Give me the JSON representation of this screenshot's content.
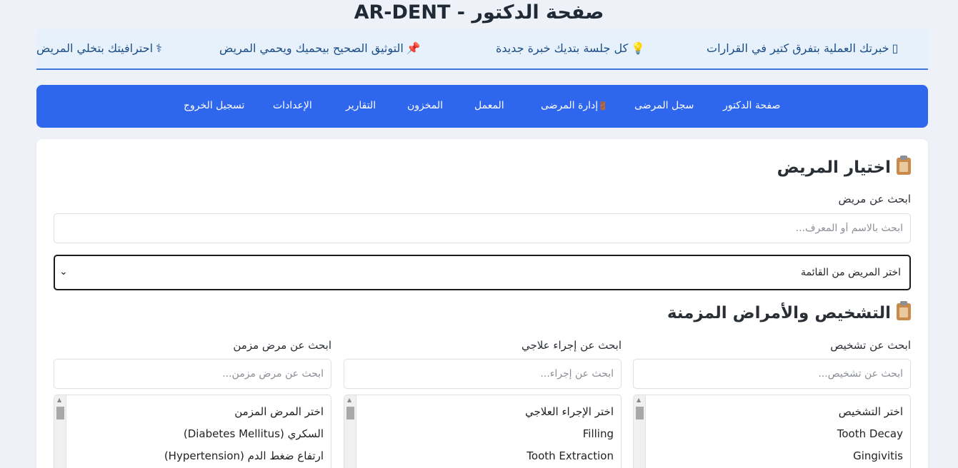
{
  "page": {
    "title": "AR-DENT - صفحة الدكتور"
  },
  "ticker": {
    "items": [
      {
        "icon": "stethoscope-icon",
        "glyph": "⚕",
        "text": "احترافيتك بتخلي المريض"
      },
      {
        "icon": "pushpin-icon",
        "glyph": "📌",
        "text": "التوثيق الصحيح بيحميك ويحمي المريض"
      },
      {
        "icon": "lightbulb-icon",
        "glyph": "💡",
        "text": "كل جلسة بتديك خبرة جديدة"
      },
      {
        "icon": "missing-glyph-icon",
        "glyph": "▯",
        "text": "خبرتك العملية بتفرق كتير في القرارات"
      }
    ]
  },
  "nav": {
    "items": [
      {
        "label": "صفحة الدكتور"
      },
      {
        "label": "سجل المرضى"
      },
      {
        "label": "إدارة المرضى",
        "glyph": "🚪"
      },
      {
        "label": "المعمل"
      },
      {
        "label": "المخزون"
      },
      {
        "label": "التقارير"
      },
      {
        "label": "الإعدادات"
      },
      {
        "label": "تسجيل الخروج"
      }
    ]
  },
  "patient_section": {
    "title": "اختيار المريض",
    "search_label": "ابحث عن مريض",
    "search_placeholder": "ابحث بالاسم أو المعرف...",
    "select_value": "اختر المريض من القائمة"
  },
  "diagnosis_section": {
    "title": "التشخيص والأمراض المزمنة",
    "columns": [
      {
        "label": "ابحث عن تشخيص",
        "placeholder": "ابحث عن تشخيص...",
        "options": [
          "اختر التشخيص",
          "Tooth Decay",
          "Gingivitis"
        ]
      },
      {
        "label": "ابحث عن إجراء علاجي",
        "placeholder": "ابحث عن إجراء...",
        "options": [
          "اختر الإجراء العلاجي",
          "Filling",
          "Tooth Extraction"
        ]
      },
      {
        "label": "ابحث عن مرض مزمن",
        "placeholder": "ابحث عن مرض مزمن...",
        "options": [
          "اختر المرض المزمن",
          "السكري (Diabetes Mellitus)",
          "ارتفاع ضغط الدم (Hypertension)"
        ]
      }
    ]
  },
  "colors": {
    "nav_bg": "#2f66ee",
    "ticker_bg": "#e6f1fc",
    "ticker_text": "#1c4d86",
    "page_bg": "#eef1f7"
  }
}
